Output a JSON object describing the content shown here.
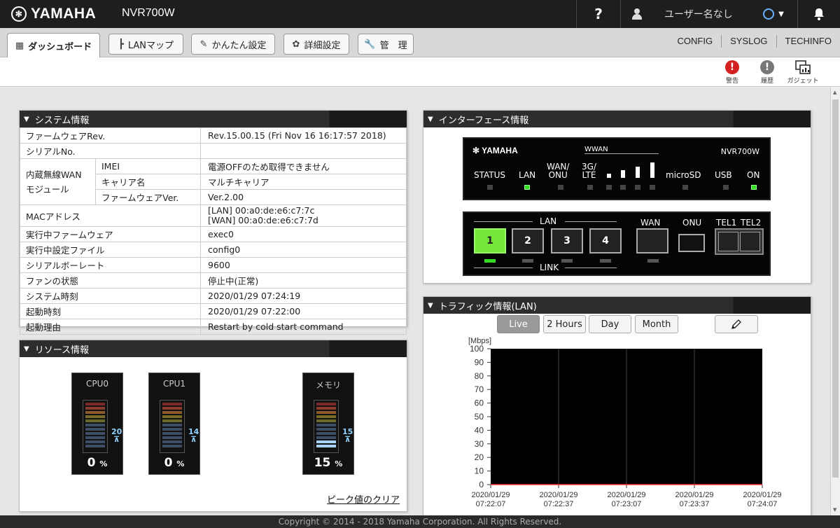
{
  "app": {
    "brand": "YAMAHA",
    "model": "NVR700W"
  },
  "topbar": {
    "help_label": "?",
    "user_label": "ユーザー名なし"
  },
  "nav": {
    "tabs": [
      {
        "label": "ダッシュボード",
        "icon": "dashboard-icon"
      },
      {
        "label": "LANマップ",
        "icon": "lanmap-icon"
      },
      {
        "label": "かんたん設定",
        "icon": "wizard-icon"
      },
      {
        "label": "詳細設定",
        "icon": "gear-icon"
      },
      {
        "label": "管　理",
        "icon": "wrench-icon"
      }
    ],
    "links": [
      "CONFIG",
      "SYSLOG",
      "TECHINFO"
    ]
  },
  "toolbar": {
    "warning_label": "警告",
    "history_label": "履歴",
    "gadget_label": "ガジェット"
  },
  "system": {
    "title": "システム情報",
    "rows": {
      "firmware_rev": {
        "label": "ファームウェアRev.",
        "value": "Rev.15.00.15 (Fri Nov 16 16:17:57 2018)"
      },
      "serial": {
        "label": "シリアルNo.",
        "value": ""
      },
      "wwan_label": "内蔵無線WAN\nモジュール",
      "imei": {
        "label": "IMEI",
        "value": "電源OFFのため取得できません"
      },
      "carrier": {
        "label": "キャリア名",
        "value": "マルチキャリア"
      },
      "wwan_fw": {
        "label": "ファームウェアVer.",
        "value": "Ver.2.00"
      },
      "mac": {
        "label": "MACアドレス",
        "value_lan": "[LAN] 00:a0:de:e6:c7:7c",
        "value_wan": "[WAN] 00:a0:de:e6:c7:7d"
      },
      "running_fw": {
        "label": "実行中ファームウェア",
        "value": "exec0"
      },
      "running_cfg": {
        "label": "実行中設定ファイル",
        "value": "config0"
      },
      "baud": {
        "label": "シリアルボーレート",
        "value": "9600"
      },
      "fan": {
        "label": "ファンの状態",
        "value": "停止中(正常)"
      },
      "sys_time": {
        "label": "システム時刻",
        "value": "2020/01/29 07:24:19"
      },
      "boot_time": {
        "label": "起動時刻",
        "value": "2020/01/29 07:22:00"
      },
      "boot_reason": {
        "label": "起動理由",
        "value": "Restart by cold start command"
      }
    }
  },
  "resource": {
    "title": "リソース情報",
    "items": [
      {
        "name": "CPU0",
        "value": "0",
        "unit": "%",
        "peak": "20",
        "level": 0,
        "peak_level": 0.2
      },
      {
        "name": "CPU1",
        "value": "0",
        "unit": "%",
        "peak": "14",
        "level": 0,
        "peak_level": 0.14
      },
      {
        "name": "メモリ",
        "value": "15",
        "unit": "%",
        "peak": "15",
        "level": 0.15,
        "peak_level": 0.15
      }
    ],
    "clear_label": "ピーク値のクリア"
  },
  "interface": {
    "title": "インターフェース情報",
    "front": {
      "brand": "YAMAHA",
      "model": "NVR700W",
      "wwan_label": "WWAN",
      "status": "STATUS",
      "lan": "LAN",
      "wan_onu": "WAN/\nONU",
      "lte": "3G/\nLTE",
      "microsd": "microSD",
      "usb": "USB",
      "on": "ON"
    },
    "back": {
      "lan_label": "LAN",
      "link_label": "LINK",
      "wan_label": "WAN",
      "onu_label": "ONU",
      "tel1_label": "TEL1",
      "tel2_label": "TEL2",
      "ports": [
        "1",
        "2",
        "3",
        "4"
      ]
    }
  },
  "traffic": {
    "title": "トラフィック情報(LAN)",
    "buttons": [
      "Live",
      "2 Hours",
      "Day",
      "Month"
    ],
    "selected": "Live"
  },
  "chart_data": {
    "type": "line",
    "ylabel": "[Mbps]",
    "ylim": [
      0,
      100
    ],
    "yticks": [
      0,
      10,
      20,
      30,
      40,
      50,
      60,
      70,
      80,
      90,
      100
    ],
    "x_labels": [
      [
        "2020/01/29",
        "07:22:07"
      ],
      [
        "2020/01/29",
        "07:22:37"
      ],
      [
        "2020/01/29",
        "07:23:07"
      ],
      [
        "2020/01/29",
        "07:23:37"
      ],
      [
        "2020/01/29",
        "07:24:07"
      ]
    ],
    "series": [
      {
        "values": [
          0,
          0,
          0,
          0,
          0
        ],
        "color": "#ff3333"
      }
    ],
    "grid": true,
    "background": "#000000"
  },
  "footer": {
    "copyright": "Copyright © 2014 - 2018 Yamaha Corporation. All Rights Reserved."
  }
}
